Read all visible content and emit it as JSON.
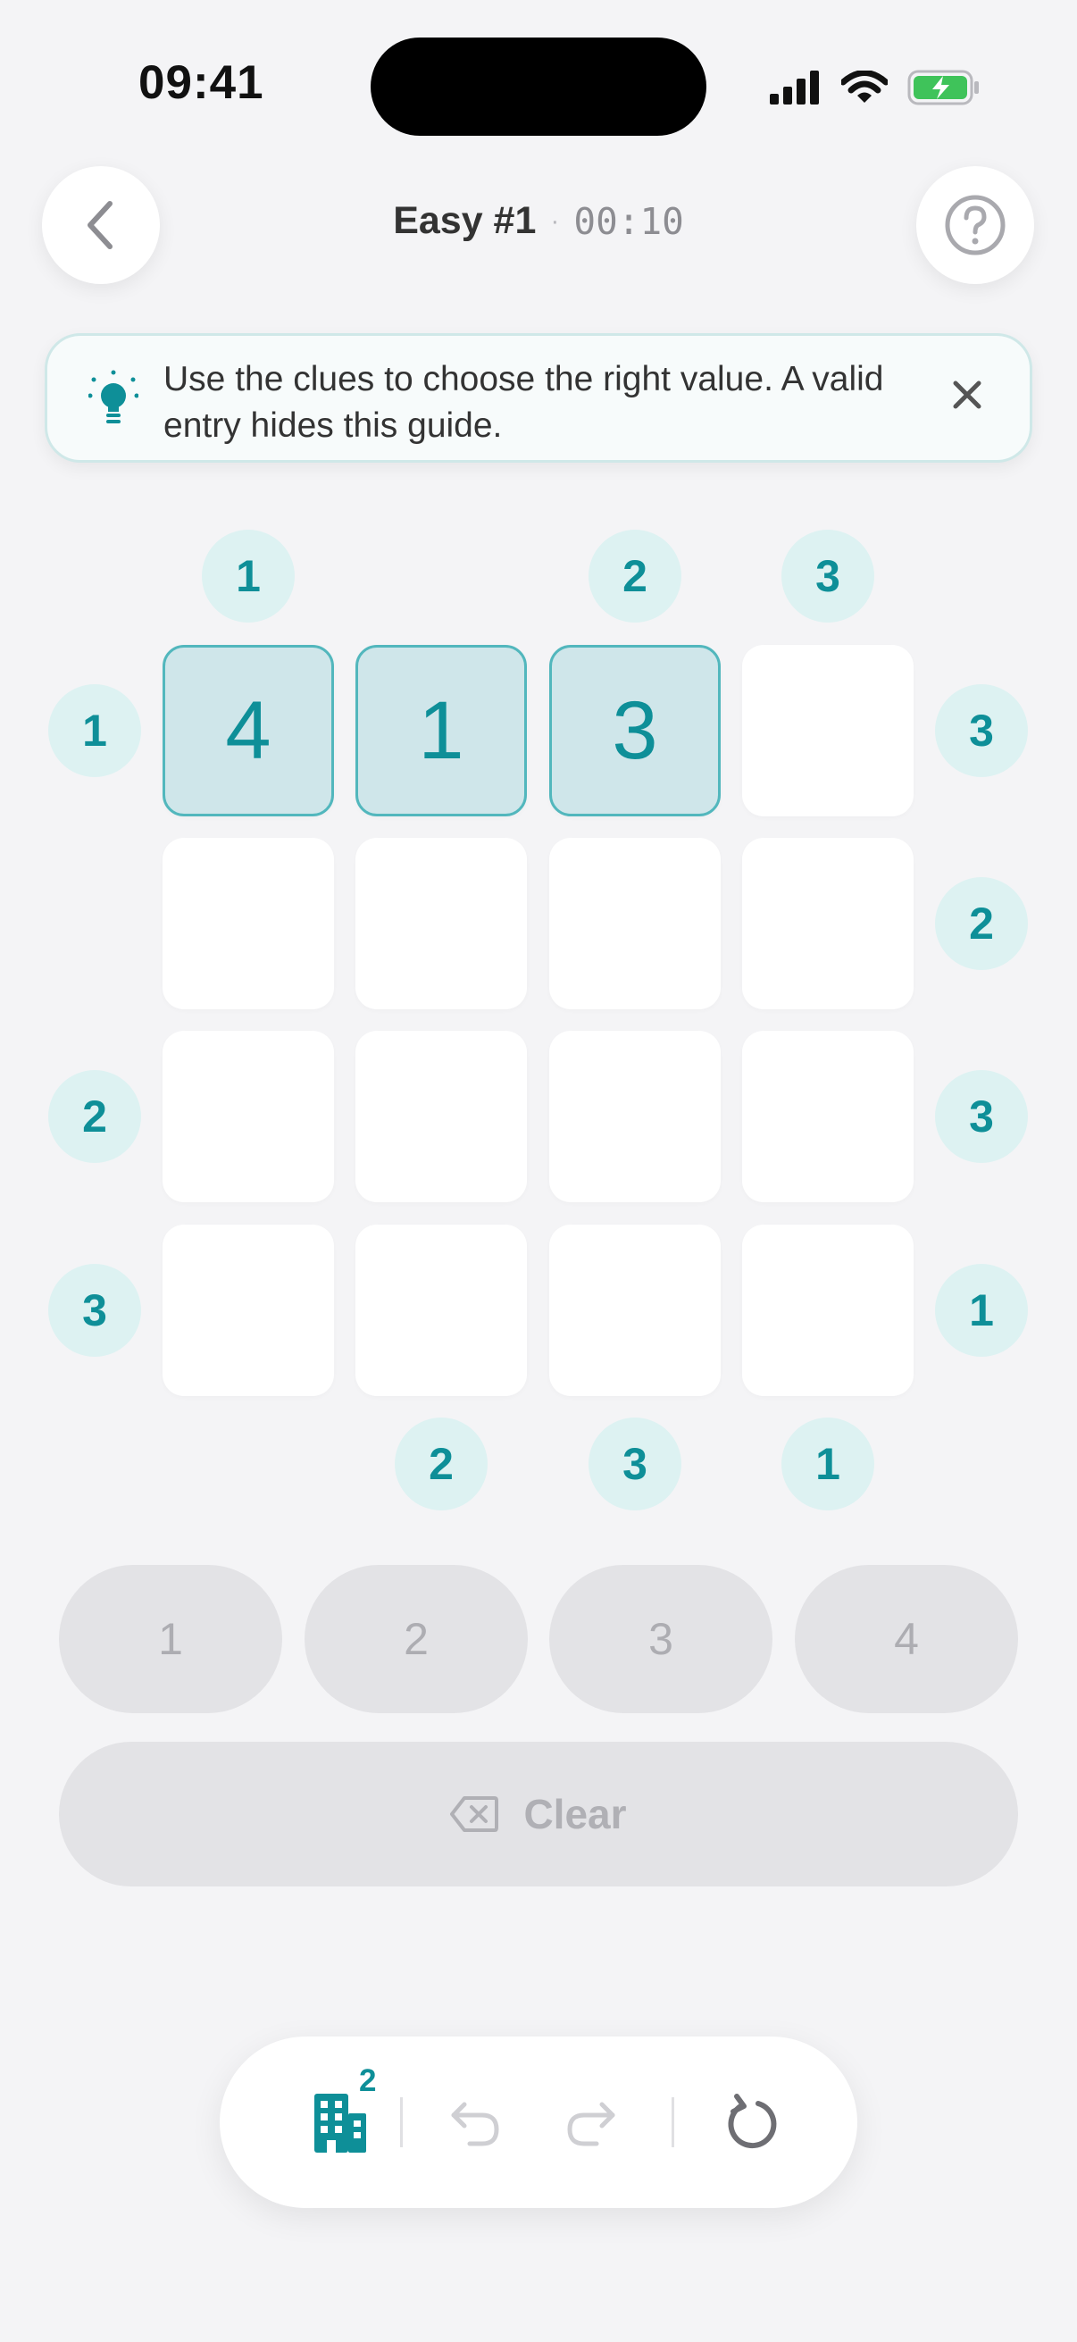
{
  "status_bar": {
    "time": "09:41",
    "icons": [
      "signal-icon",
      "wifi-icon",
      "battery-charging-icon"
    ]
  },
  "header": {
    "title": "Easy #1",
    "separator": "·",
    "timer": "00:10"
  },
  "hint": {
    "text": "Use the clues to choose the right value. A valid entry hides this guide."
  },
  "clues": {
    "top": [
      "1",
      "",
      "2",
      "3"
    ],
    "bottom": [
      "",
      "2",
      "3",
      "1"
    ],
    "left": [
      "1",
      "",
      "2",
      "3"
    ],
    "right": [
      "3",
      "2",
      "3",
      "1"
    ]
  },
  "grid": {
    "rows": [
      [
        "4",
        "1",
        "3",
        ""
      ],
      [
        "",
        "",
        "",
        ""
      ],
      [
        "",
        "",
        "",
        ""
      ],
      [
        "",
        "",
        "",
        ""
      ]
    ]
  },
  "number_pad": [
    "1",
    "2",
    "3",
    "4"
  ],
  "clear_button": {
    "label": "Clear"
  },
  "toolbar": {
    "buildings_badge": "2",
    "tools": [
      "buildings-icon",
      "undo-icon",
      "redo-icon",
      "restart-icon"
    ]
  },
  "colors": {
    "accent": "#0e8f98",
    "clue_bg": "#ddf2f2",
    "filled_cell_bg": "#cfe6ea",
    "background": "#f4f4f6"
  }
}
